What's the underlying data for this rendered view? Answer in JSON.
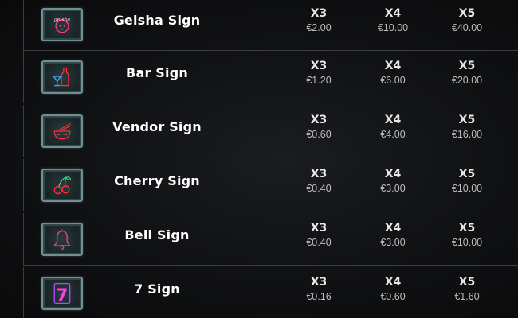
{
  "paytable": {
    "rows": [
      {
        "name": "Geisha Sign",
        "icon": "geisha-sign-icon",
        "payouts": [
          {
            "mult": "X3",
            "value": "€2.00"
          },
          {
            "mult": "X4",
            "value": "€10.00"
          },
          {
            "mult": "X5",
            "value": "€40.00"
          }
        ]
      },
      {
        "name": "Bar Sign",
        "icon": "bar-sign-icon",
        "payouts": [
          {
            "mult": "X3",
            "value": "€1.20"
          },
          {
            "mult": "X4",
            "value": "€6.00"
          },
          {
            "mult": "X5",
            "value": "€20.00"
          }
        ]
      },
      {
        "name": "Vendor Sign",
        "icon": "vendor-sign-icon",
        "payouts": [
          {
            "mult": "X3",
            "value": "€0.60"
          },
          {
            "mult": "X4",
            "value": "€4.00"
          },
          {
            "mult": "X5",
            "value": "€16.00"
          }
        ]
      },
      {
        "name": "Cherry Sign",
        "icon": "cherry-sign-icon",
        "payouts": [
          {
            "mult": "X3",
            "value": "€0.40"
          },
          {
            "mult": "X4",
            "value": "€3.00"
          },
          {
            "mult": "X5",
            "value": "€10.00"
          }
        ]
      },
      {
        "name": "Bell Sign",
        "icon": "bell-sign-icon",
        "payouts": [
          {
            "mult": "X3",
            "value": "€0.40"
          },
          {
            "mult": "X4",
            "value": "€3.00"
          },
          {
            "mult": "X5",
            "value": "€10.00"
          }
        ]
      },
      {
        "name": "7 Sign",
        "icon": "seven-sign-icon",
        "payouts": [
          {
            "mult": "X3",
            "value": "€0.16"
          },
          {
            "mult": "X4",
            "value": "€0.60"
          },
          {
            "mult": "X5",
            "value": "€1.60"
          }
        ]
      }
    ],
    "icon_glyphs": {
      "geisha-sign-icon": "geisha",
      "seven-sign-icon": "7"
    },
    "colors": {
      "background": "#0b0b0c",
      "divider": "#3a3c40",
      "frame": "#6f8f92",
      "neon_pink": "#ff3d8b",
      "neon_red": "#ff2a3a",
      "neon_blue": "#3fa8ff",
      "neon_purple": "#b04dff"
    }
  }
}
